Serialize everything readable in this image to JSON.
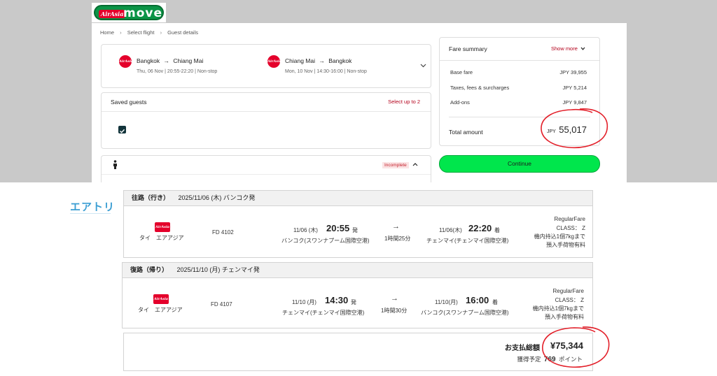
{
  "airasia": {
    "logo": {
      "badge": "AirAsia",
      "word": "move"
    },
    "breadcrumb": [
      "Home",
      "Select flight",
      "Guest details"
    ],
    "flights": [
      {
        "badge": "AirAsia",
        "from": "Bangkok",
        "to": "Chiang Mai",
        "arrow": "→",
        "details": "Thu, 06 Nov  |  20:55-22:20  |  Non-stop"
      },
      {
        "badge": "AirAsia",
        "from": "Chiang Mai",
        "to": "Bangkok",
        "arrow": "→",
        "details": "Mon, 10 Nov  |  14:30-16:00  |  Non-stop"
      }
    ],
    "saved_guests": {
      "title": "Saved guests",
      "action": "Select up to 2"
    },
    "guest": {
      "status": "Incomplete"
    },
    "fare_summary": {
      "title": "Fare summary",
      "show_more": "Show more",
      "rows": [
        {
          "label": "Base fare",
          "value": "JPY 39,955"
        },
        {
          "label": "Taxes, fees & surcharges",
          "value": "JPY 5,214"
        },
        {
          "label": "Add-ons",
          "value": "JPY 9,847"
        }
      ],
      "total_label": "Total amount",
      "total_currency": "JPY",
      "total_value": "55,017"
    },
    "continue_label": "Continue"
  },
  "airtrip": {
    "logo": "エアトリ",
    "segments": [
      {
        "header_dir": "往路（行き）",
        "header_date": "2025/11/06 (木) バンコク発",
        "airline_badge": "AirAsia",
        "airline": "タイ　エアアジア",
        "flight_no": "FD 4102",
        "dep_date": "11/06 (木)",
        "dep_time": "20:55",
        "dep_suffix": "発",
        "dep_airport": "バンコク(スワンナプーム国際空港)",
        "arrow": "→",
        "duration": "1時間25分",
        "arr_date": "11/06(木)",
        "arr_time": "22:20",
        "arr_suffix": "着",
        "arr_airport": "チェンマイ(チェンマイ国際空港)",
        "fare": [
          "RegularFare",
          "CLASS： Z",
          "機内持込1個7kgまで",
          "預入手荷物有料"
        ]
      },
      {
        "header_dir": "復路（帰り）",
        "header_date": "2025/11/10 (月) チェンマイ発",
        "airline_badge": "AirAsia",
        "airline": "タイ　エアアジア",
        "flight_no": "FD 4107",
        "dep_date": "11/10 (月)",
        "dep_time": "14:30",
        "dep_suffix": "発",
        "dep_airport": "チェンマイ(チェンマイ国際空港)",
        "arrow": "→",
        "duration": "1時間30分",
        "arr_date": "11/10(月)",
        "arr_time": "16:00",
        "arr_suffix": "着",
        "arr_airport": "バンコク(スワンナプーム国際空港)",
        "fare": [
          "RegularFare",
          "CLASS： Z",
          "機内持込1個7kgまで",
          "預入手荷物有料"
        ]
      }
    ],
    "total": {
      "label": "お支払総額",
      "value": "¥75,344",
      "points_prefix": "獲得予定",
      "points_value": "769",
      "points_suffix": "ポイント"
    }
  },
  "colors": {
    "airasia_red": "#e4002b",
    "move_green": "#0b9446",
    "continue_green": "#00e64c",
    "annotation_red": "#e3202a",
    "airtrip_blue": "#3b9ed3"
  }
}
